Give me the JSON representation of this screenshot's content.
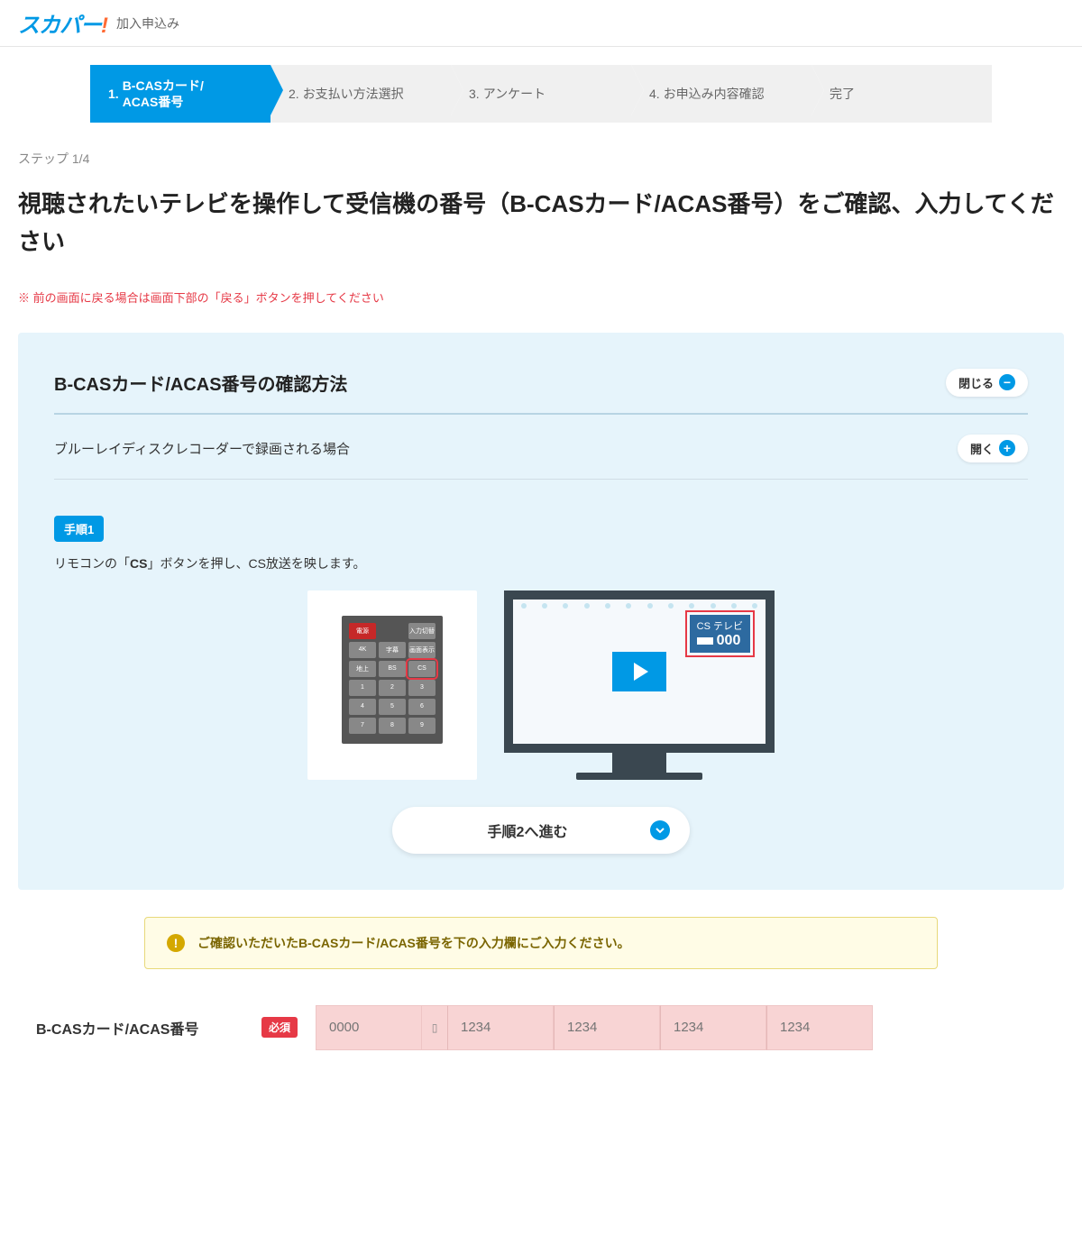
{
  "header": {
    "logo_main": "スカパー",
    "logo_bang": "!",
    "subtitle": "加入申込み"
  },
  "stepper": [
    {
      "num": "1.",
      "label": "B-CASカード/\nACAS番号",
      "active": true
    },
    {
      "num": "2.",
      "label": "お支払い方法選択",
      "active": false
    },
    {
      "num": "3.",
      "label": "アンケート",
      "active": false
    },
    {
      "num": "4.",
      "label": "お申込み内容確認",
      "active": false
    },
    {
      "num": "",
      "label": "完了",
      "active": false
    }
  ],
  "step_indicator": "ステップ 1/4",
  "main_heading": "視聴されたいテレビを操作して受信機の番号（B-CASカード/ACAS番号）をご確認、入力してください",
  "warning_text": "※ 前の画面に戻る場合は画面下部の「戻る」ボタンを押してください",
  "panel": {
    "title": "B-CASカード/ACAS番号の確認方法",
    "close_label": "閉じる",
    "sub_title": "ブルーレイディスクレコーダーで録画される場合",
    "open_label": "開く",
    "step_badge": "手順1",
    "step_desc_pre": "リモコンの「",
    "step_desc_strong": "CS",
    "step_desc_post": "」ボタンを押し、CS放送を映します。",
    "tv_label_top": "CS テレビ",
    "tv_label_num": "000",
    "remote": {
      "power": "電源",
      "input": "入力切替",
      "r2": [
        "4K",
        "字幕",
        "画面表示"
      ],
      "r3": [
        "地上",
        "BS",
        "CS"
      ],
      "r4": [
        "1",
        "2",
        "3"
      ],
      "r5": [
        "4",
        "5",
        "6"
      ],
      "r6": [
        "7",
        "8",
        "9"
      ]
    },
    "next_step_btn": "手順2へ進む"
  },
  "alert_text": "ご確認いただいたB-CASカード/ACAS番号を下の入力欄にご入力ください。",
  "form": {
    "label": "B-CASカード/ACAS番号",
    "required": "必須",
    "placeholders": [
      "0000",
      "1234",
      "1234",
      "1234",
      "1234"
    ]
  }
}
